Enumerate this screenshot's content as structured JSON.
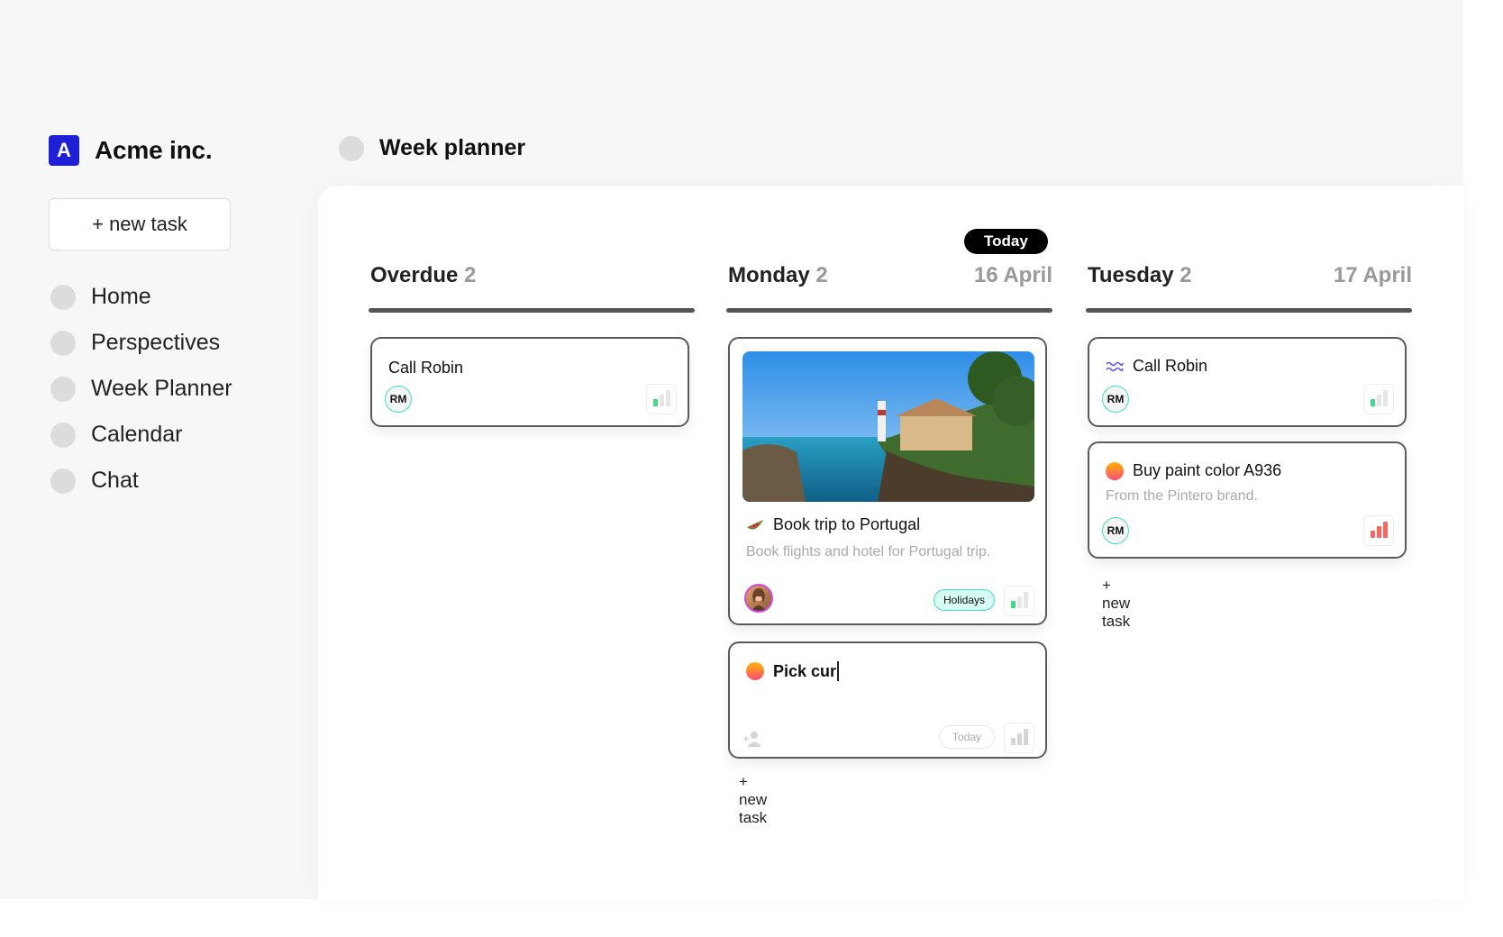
{
  "sidebar": {
    "brand": {
      "logo_letter": "A",
      "name": "Acme inc.",
      "logo_color": "#1f1fd6"
    },
    "new_task_label": "+ new task",
    "items": [
      {
        "label": "Home"
      },
      {
        "label": "Perspectives"
      },
      {
        "label": "Week Planner"
      },
      {
        "label": "Calendar"
      },
      {
        "label": "Chat"
      }
    ]
  },
  "header": {
    "title": "Week planner"
  },
  "board": {
    "today_badge": "Today",
    "columns": [
      {
        "name": "Overdue",
        "count": "2",
        "date": "",
        "cards": [
          {
            "title": "Call Robin",
            "assignee": "RM",
            "priority": "low"
          }
        ],
        "add_label": ""
      },
      {
        "name": "Monday",
        "count": "2",
        "date": "16 April",
        "cards": [
          {
            "title": "Book trip to Portugal",
            "icon": "watermelon-icon",
            "description": "Book flights and hotel for Portugal trip.",
            "tag": "Holidays",
            "priority": "low",
            "has_image": true
          },
          {
            "title": "Pick cur",
            "icon": "sunset-icon",
            "editing": true,
            "date_chip": "Today",
            "priority": "none"
          }
        ],
        "add_label": "+ new task"
      },
      {
        "name": "Tuesday",
        "count": "2",
        "date": "17 April",
        "cards": [
          {
            "title": "Call Robin",
            "icon": "waves-icon",
            "assignee": "RM",
            "priority": "low"
          },
          {
            "title": "Buy paint color A936",
            "icon": "sunset-icon",
            "description": "From the Pintero brand.",
            "assignee": "RM",
            "priority": "high"
          }
        ],
        "add_label": "+ new task"
      }
    ]
  },
  "colors": {
    "accent_teal": "#3ee0c4",
    "priority_low": "#3ddc84",
    "priority_high": "#ff6460"
  }
}
